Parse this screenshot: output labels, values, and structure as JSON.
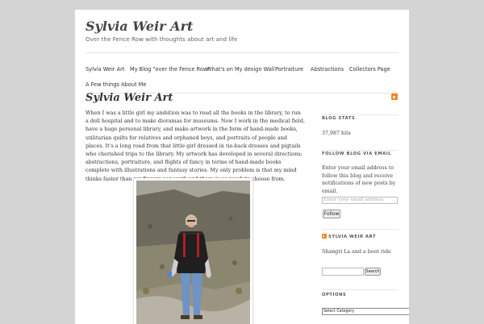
{
  "site": {
    "title": "Sylvia Weir Art",
    "description": "Over the Fence Row with thoughts about art and life"
  },
  "nav": {
    "items": [
      "Sylvia Weir Art",
      "My Blog \"over the Fence Row\"",
      "What's on My design Wall",
      "Portraiture",
      "Abstractions",
      "Collectors Page",
      "A Few things About Me"
    ]
  },
  "post": {
    "title": "Sylvia Weir Art",
    "body": "When I was a little girl my ambition was to read all the books in the library, to run a doll hospital and to make dioramas for museums. Now I work in the medical field, have a huge personal library, and make artwork in the form of hand-made books, utilitarian quilts for relatives and orphaned boys, and portraits of people and places. It's a long road from that little girl dressed in tie-back dresses and pigtails who cherished trips to the library. My artwork has developed in several directions; abstractions, portraiture, and flights of fancy in terms of hand-made books complete with illustrations and fantasy stories. My only problem is that my mind thinks faster than my fingers can work and there is so much to choose from."
  },
  "icons": {
    "rss_top": "rss-icon",
    "rss_small": "rss-icon"
  },
  "sidebar": {
    "blog_stats": {
      "title": "BLOG STATS",
      "hits": "37,987 hits"
    },
    "follow": {
      "title": "FOLLOW BLOG VIA EMAIL",
      "text": "Enter your email address to follow this blog and receive notifications of new posts by email.",
      "placeholder": "Enter your email address",
      "button": "Follow"
    },
    "rss": {
      "title": "SYLVIA WEIR ART",
      "entry": "Shangri La and a boot ride"
    },
    "search": {
      "button": "Search"
    },
    "options": {
      "title": "OPTIONS",
      "select": "Select Category"
    }
  },
  "colors": {
    "background": "#d4d4d4",
    "page": "#ffffff",
    "rss": "#f78422"
  }
}
